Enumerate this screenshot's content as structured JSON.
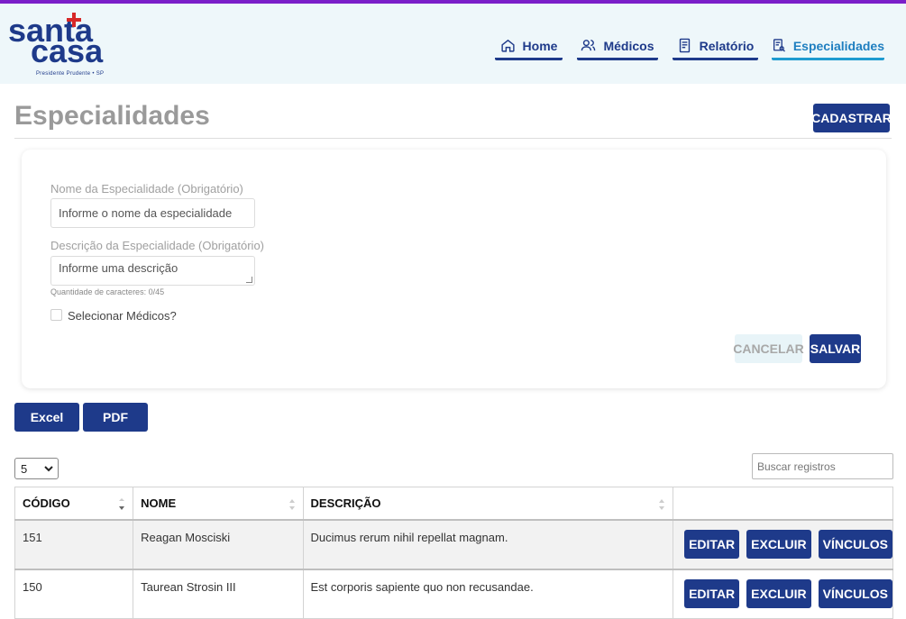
{
  "logo": {
    "line1": "santa",
    "line2": "casa",
    "subtitle": "Presidente Prudente • SP"
  },
  "nav": {
    "items": [
      {
        "label": "Home",
        "icon": "home-icon"
      },
      {
        "label": "Médicos",
        "icon": "users-icon"
      },
      {
        "label": "Relatório",
        "icon": "report-icon"
      },
      {
        "label": "Especialidades",
        "icon": "specialties-icon",
        "active": true
      }
    ]
  },
  "page": {
    "title": "Especialidades",
    "cadastrar_label": "CADASTRAR"
  },
  "form": {
    "nome_label": "Nome da Especialidade (Obrigatório)",
    "nome_placeholder": "Informe o nome da especialidade",
    "descricao_label": "Descrição da Especialidade (Obrigatório)",
    "descricao_placeholder": "Informe uma descrição",
    "counter": "Quantidade de caracteres: 0/45",
    "checkbox_label": "Selecionar Médicos?",
    "cancel_label": "CANCELAR",
    "save_label": "SALVAR"
  },
  "export": {
    "excel_label": "Excel",
    "pdf_label": "PDF"
  },
  "table_controls": {
    "page_size": "5",
    "search_placeholder": "Buscar registros"
  },
  "table": {
    "headers": [
      "CÓDIGO",
      "NOME",
      "DESCRIÇÃO"
    ],
    "rows": [
      {
        "codigo": "151",
        "nome": "Reagan Mosciski",
        "descricao": "Ducimus rerum nihil repellat magnam."
      },
      {
        "codigo": "150",
        "nome": "Taurean Strosin III",
        "descricao": "Est corporis sapiente quo non recusandae."
      }
    ],
    "actions": {
      "edit": "EDITAR",
      "delete": "EXCLUIR",
      "links": "VÍNCULOS"
    }
  },
  "colors": {
    "primary": "#1e3a8a",
    "accent": "#1f9bd0",
    "header_bg": "#eef7fa",
    "topbar": "#7b1fc9",
    "logo_cross": "#d62828"
  }
}
